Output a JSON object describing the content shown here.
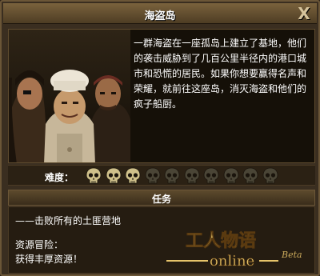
{
  "window": {
    "title": "海盗岛",
    "close_glyph": "X",
    "close_icon": "close-icon"
  },
  "story": {
    "lines": [
      "一群海盗在一座孤岛上建立了基地，他们",
      "的袭击威胁到了几百公里半径内的港口城",
      "市和恐慌的居民。如果你想要赢得名声和",
      "荣耀，就前往这座岛，消灭海盗和他们的",
      "疯子船厨。"
    ]
  },
  "difficulty": {
    "label": "难度：",
    "level": 3,
    "max": 10,
    "active_color": "#cfc08a",
    "inactive_color": "#4a4536"
  },
  "mission": {
    "header": "任务",
    "objective": "——击败所有的土匪营地",
    "reward_label": "资源冒险：",
    "reward_text": "获得丰厚资源！"
  },
  "watermark": {
    "main": "工人物语",
    "sub": "online",
    "tag": "Beta"
  },
  "colors": {
    "accent_gold": "#e6c46a",
    "panel_bg": "#3a2e20"
  }
}
